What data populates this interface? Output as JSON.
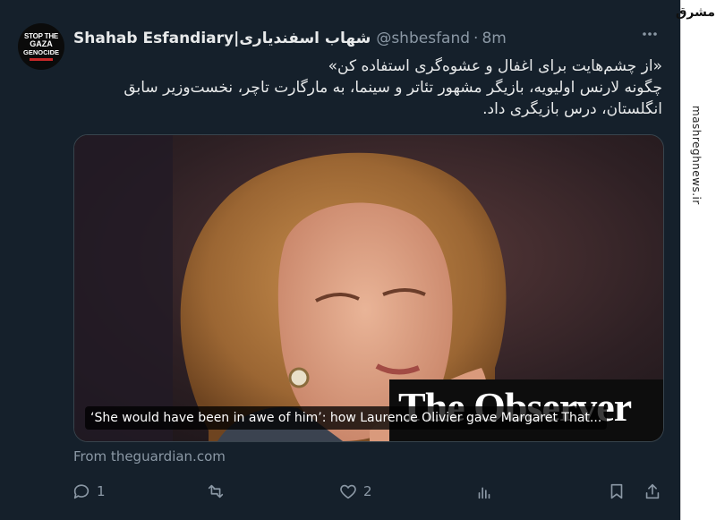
{
  "tweet": {
    "avatar": {
      "line1": "STOP THE",
      "line2": "GAZA",
      "line3": "GENOCIDE"
    },
    "author_name": "Shahab Esfandiary|شهاب اسفندیاری",
    "handle": "@shbesfand",
    "separator": "·",
    "time": "8m",
    "more_icon": "more-dots-icon",
    "text_lines": [
      "«از چشم‌هایت برای اغفال و عشوه‌گری استفاده کن»",
      "چگونه لارنس اولیویه، بازیگر مشهور تئاتر و سینما، به مارگارت تاچر، نخست‌وزیر سابق",
      "انگلستان، درس بازیگری داد."
    ]
  },
  "card": {
    "image_text": "The Observer",
    "caption": "‘She would have been in awe of him’: how Laurence Olivier gave Margaret That...",
    "source": "From theguardian.com"
  },
  "actions": {
    "reply_count": "1",
    "retweet_count": "",
    "like_count": "2",
    "views_count": ""
  },
  "watermark": {
    "logo": "مشرق",
    "url": "mashreghnews.ir"
  },
  "colors": {
    "background": "#15202b",
    "text": "#e7e9ea",
    "muted": "#8b98a5",
    "border": "#38444d"
  }
}
